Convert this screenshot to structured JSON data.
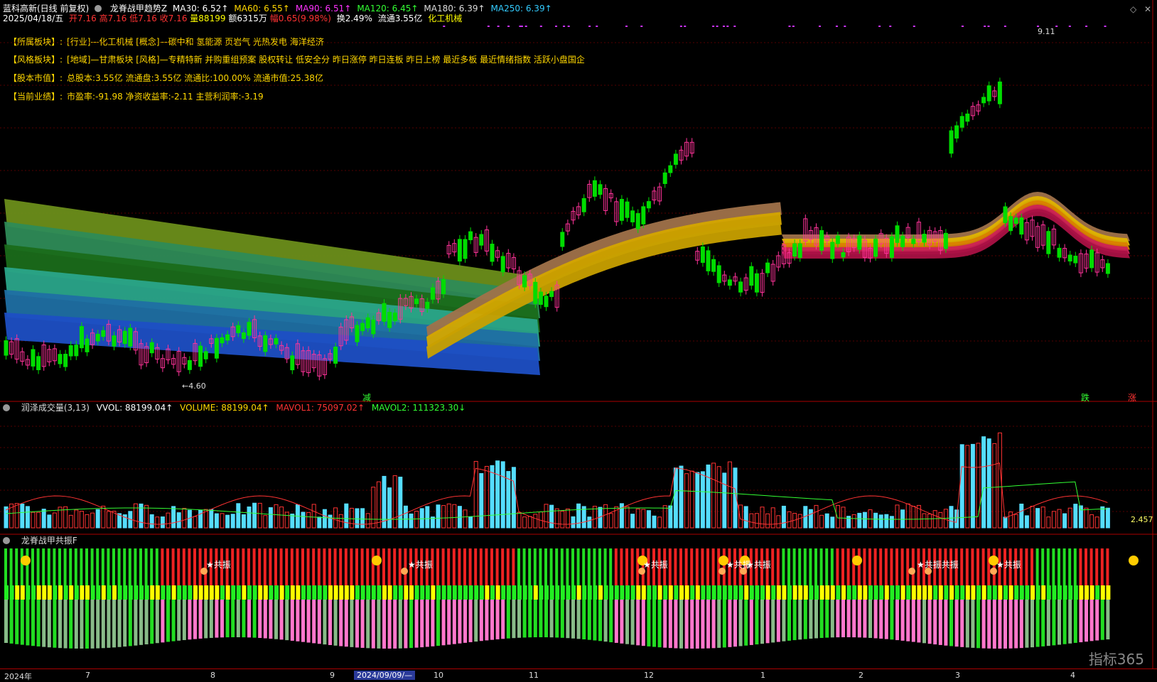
{
  "header": {
    "stock_name": "蓝科高新(日线 前复权)",
    "indicator_name": "龙脊战甲趋势Z",
    "mas": [
      {
        "label": "MA30: 6.52↑",
        "color": "#ffffff"
      },
      {
        "label": "MA60: 6.55↑",
        "color": "#ffd700"
      },
      {
        "label": "MA90: 6.51↑",
        "color": "#ff33ff"
      },
      {
        "label": "MA120: 6.45↑",
        "color": "#33ff33"
      },
      {
        "label": "MA180: 6.39↑",
        "color": "#dddddd"
      },
      {
        "label": "MA250: 6.39↑",
        "color": "#33ccff"
      }
    ],
    "date": "2025/04/18/五",
    "open": "开7.16",
    "high": "高7.16",
    "low": "低7.16",
    "close": "收7.16",
    "volume": "量88199",
    "amount": "额6315万",
    "change": "幅0.65(9.98%)",
    "turnover": "换2.49%",
    "float_shares": "流通3.55亿",
    "sector": "化工机械"
  },
  "info": [
    {
      "key": "【所属板块】:",
      "value": "[行业]—化工机械 [概念]—碳中和 氢能源 页岩气 光热发电 海洋经济"
    },
    {
      "key": "【风格板块】:",
      "value": "[地域]—甘肃板块 [风格]—专精特新 并购重组预案 股权转让 低安全分 昨日涨停 昨日连板 昨日上榜 最近多板 最近情绪指数 活跃小盘国企"
    },
    {
      "key": "【股本市值】:",
      "value": "总股本:3.55亿 流通盘:3.55亿 流通比:100.00% 流通市值:25.38亿"
    },
    {
      "key": "【当前业绩】:",
      "value": "市盈率:-91.98 净资收益率:-2.11 主营利润率:-3.19"
    }
  ],
  "main_chart": {
    "high_label": "9.11",
    "low_label": "←4.60",
    "marker_jian": "减",
    "marker_die": "跌",
    "marker_zhang": "涨"
  },
  "volume_panel": {
    "title": "润泽成交量(3,13)",
    "vvol": "VVOL: 88199.04↑",
    "volume": "VOLUME: 88199.04↑",
    "mavol1": "MAVOL1: 75097.02↑",
    "mavol2": "MAVOL2: 111323.30↓",
    "right_value": "2.457"
  },
  "resonance_panel": {
    "title": "龙脊战甲共振F",
    "labels": [
      "★共振",
      "★共振",
      "★共振",
      "★共振",
      "★共振",
      "★共振共振",
      "★共振"
    ]
  },
  "xaxis": {
    "labels": [
      "2024年",
      "7",
      "8",
      "9",
      "2024/09/09/—",
      "10",
      "11",
      "12",
      "1",
      "2",
      "3",
      "4"
    ]
  },
  "watermark": "指标365",
  "colors": {
    "up": "#ff3399",
    "down": "#00dd00",
    "bg": "#000000",
    "grid": "#8b0000"
  }
}
